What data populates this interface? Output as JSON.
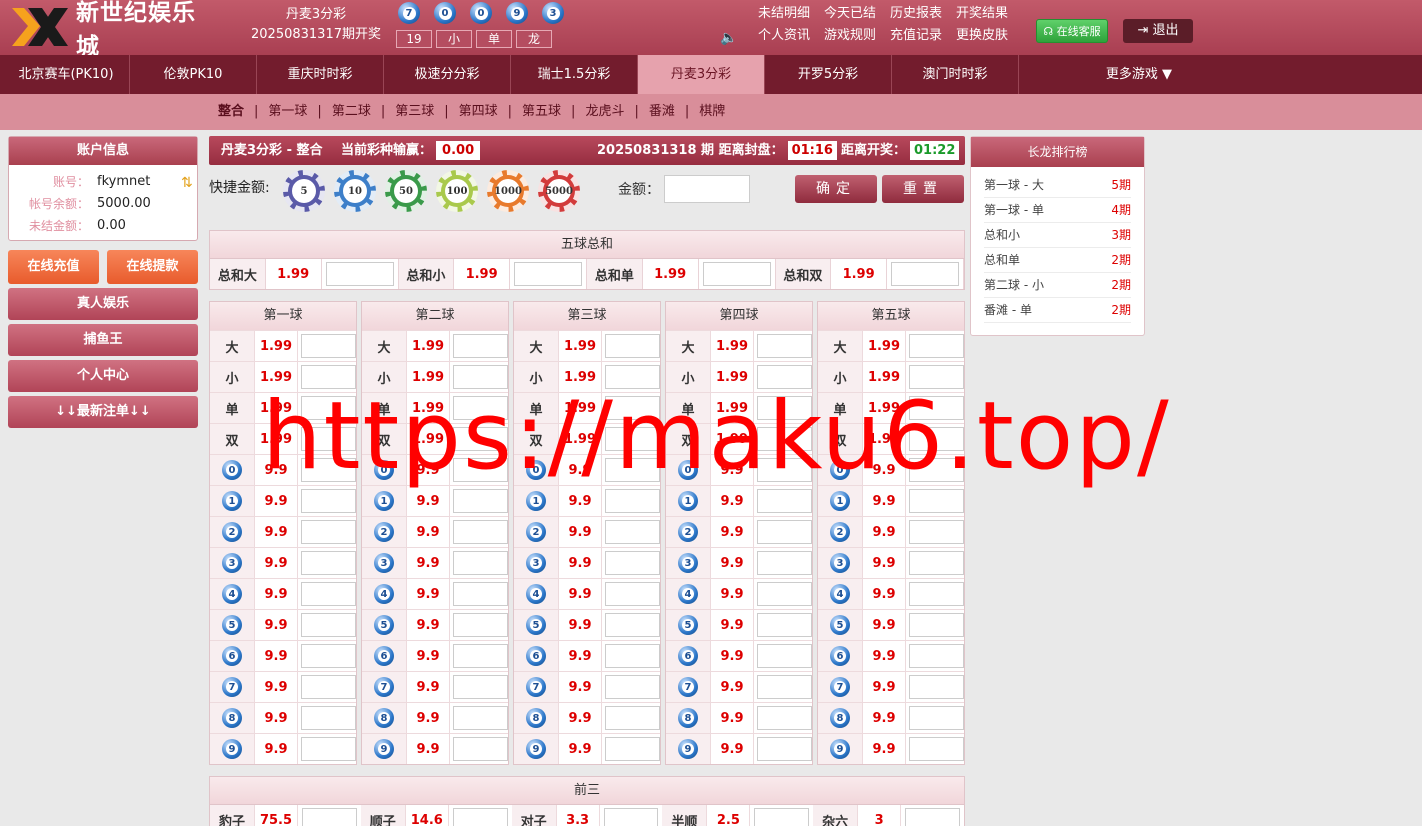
{
  "header": {
    "site_name": "新世纪娱乐城",
    "current_game": "丹麦3分彩",
    "last_issue": "20250831317期开奖",
    "last_balls": [
      "7",
      "0",
      "0",
      "9",
      "3"
    ],
    "last_tags": [
      "19",
      "小",
      "单",
      "龙"
    ],
    "links_row1": [
      "未结明细",
      "今天已结",
      "历史报表",
      "开奖结果"
    ],
    "links_row2": [
      "个人资讯",
      "游戏规则",
      "充值记录",
      "更换皮肤"
    ],
    "kefu": "在线客服",
    "logout": "退出"
  },
  "nav": {
    "items": [
      "北京赛车(PK10)",
      "伦敦PK10",
      "重庆时时彩",
      "极速分分彩",
      "瑞士1.5分彩",
      "丹麦3分彩",
      "开罗5分彩",
      "澳门时时彩"
    ],
    "more": "更多游戏 ▼",
    "active": "丹麦3分彩"
  },
  "subnav": [
    "整合",
    "第一球",
    "第二球",
    "第三球",
    "第四球",
    "第五球",
    "龙虎斗",
    "番滩",
    "棋牌"
  ],
  "account": {
    "title": "账户信息",
    "user_label": "账号：",
    "user": "fkymnet",
    "balance_label": "帐号余额：",
    "balance": "5000.00",
    "pending_label": "未结金额：",
    "pending": "0.00",
    "recharge": "在线充值",
    "withdraw": "在线提款",
    "menu": [
      "真人娱乐",
      "捕鱼王",
      "个人中心",
      "↓↓最新注单↓↓"
    ]
  },
  "bar": {
    "left": "丹麦3分彩 - 整合",
    "profit_label": "当前彩种输赢：",
    "profit": "0.00",
    "issue": "20250831318 期",
    "close_label": "距离封盘：",
    "close": "01:16",
    "open_label": "距离开奖：",
    "open": "01:22"
  },
  "chips": {
    "label": "快捷金额:",
    "values": [
      "5",
      "10",
      "50",
      "100",
      "1000",
      "5000"
    ],
    "colors": [
      "#5a5aa8",
      "#3d7fc9",
      "#3a9a4a",
      "#a9c94c",
      "#e87a2c",
      "#d23b3b"
    ],
    "amount_label": "金额：",
    "confirm": "确定",
    "reset": "重置"
  },
  "total": {
    "title": "五球总和",
    "items": [
      {
        "k": "总和大",
        "o": "1.99"
      },
      {
        "k": "总和小",
        "o": "1.99"
      },
      {
        "k": "总和单",
        "o": "1.99"
      },
      {
        "k": "总和双",
        "o": "1.99"
      }
    ]
  },
  "balls": {
    "titles": [
      "第一球",
      "第二球",
      "第三球",
      "第四球",
      "第五球"
    ],
    "big_small": [
      {
        "k": "大",
        "o": "1.99"
      },
      {
        "k": "小",
        "o": "1.99"
      },
      {
        "k": "单",
        "o": "1.99"
      },
      {
        "k": "双",
        "o": "1.99"
      }
    ],
    "digits": [
      "0",
      "1",
      "2",
      "3",
      "4",
      "5",
      "6",
      "7",
      "8",
      "9"
    ],
    "digit_odds": "9.9"
  },
  "front3": {
    "title": "前三",
    "items": [
      {
        "k": "豹子",
        "o": "75.5"
      },
      {
        "k": "顺子",
        "o": "14.6"
      },
      {
        "k": "对子",
        "o": "3.3"
      },
      {
        "k": "半顺",
        "o": "2.5"
      },
      {
        "k": "杂六",
        "o": "3"
      }
    ]
  },
  "rank": {
    "title": "长龙排行榜",
    "items": [
      {
        "name": "第一球 - 大",
        "periods": "5期"
      },
      {
        "name": "第一球 - 单",
        "periods": "4期"
      },
      {
        "name": "总和小",
        "periods": "3期"
      },
      {
        "name": "总和单",
        "periods": "2期"
      },
      {
        "name": "第二球 - 小",
        "periods": "2期"
      },
      {
        "name": "番滩 - 单",
        "periods": "2期"
      }
    ]
  },
  "watermark": "https://maku6.top/"
}
